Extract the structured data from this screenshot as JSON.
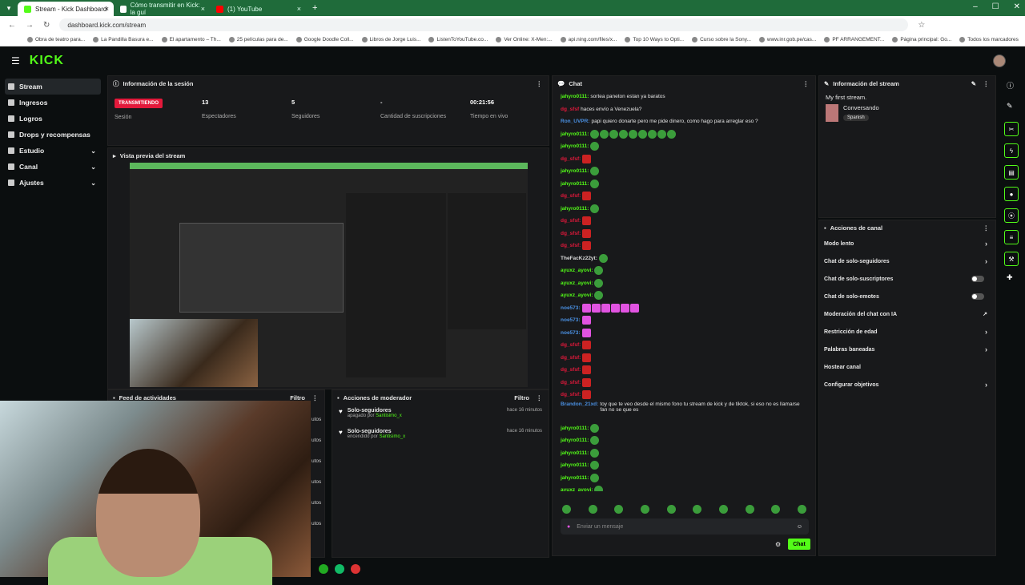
{
  "browser": {
    "tabs": [
      {
        "label": "Stream - Kick Dashboard",
        "active": true
      },
      {
        "label": "Cómo transmitir en Kick: la guí"
      },
      {
        "label": "(1) YouTube"
      }
    ],
    "url": "dashboard.kick.com/stream",
    "bookmarks": [
      "Obra de teatro para...",
      "La Pandilla Basura e...",
      "El apartamento – Th...",
      "25 películas para de...",
      "Google Doodle Coll...",
      "Libros de Jorge Luis...",
      "ListenToYouTube.co...",
      "Ver Online: X-Men:...",
      "api.ning.com/files/x...",
      "Top 10 Ways to Opti...",
      "Curso sobre la Sony...",
      "www.inr.gob.pe/cas...",
      "PF ARRANGEMENT...",
      "Página principal: Go...",
      "Todos los marcadores"
    ]
  },
  "brand": {
    "logo": "KICK",
    "accent": "#53fc18"
  },
  "sidebar": {
    "items": [
      {
        "label": "Stream",
        "active": true
      },
      {
        "label": "Ingresos"
      },
      {
        "label": "Logros"
      },
      {
        "label": "Drops y recompensas"
      },
      {
        "label": "Estudio",
        "chevron": true
      },
      {
        "label": "Canal",
        "chevron": true
      },
      {
        "label": "Ajustes",
        "chevron": true
      }
    ]
  },
  "session": {
    "title": "Información de la sesión",
    "live_badge": "TRANSMITIENDO",
    "live_label": "Sesión",
    "stats": [
      {
        "value": "13",
        "label": "Espectadores"
      },
      {
        "value": "5",
        "label": "Seguidores"
      },
      {
        "value": "-",
        "label": "Cantidad de suscripciones"
      },
      {
        "value": "00:21:56",
        "label": "Tiempo en vivo"
      }
    ]
  },
  "preview": {
    "title": "Vista previa del stream"
  },
  "activity": {
    "title": "Feed de actividades",
    "filter": "Filtro",
    "side_labels": [
      "utos",
      "utos",
      "utos",
      "utos",
      "utos",
      "utos"
    ]
  },
  "moderator": {
    "title": "Acciones de moderador",
    "filter": "Filtro",
    "items": [
      {
        "title": "Solo-seguidores",
        "action": "apagado por",
        "user": "Santisimo_x",
        "time": "hace 16 minutos"
      },
      {
        "title": "Solo-seguidores",
        "action": "encendido por",
        "user": "Santisimo_x",
        "time": "hace 16 minutos"
      }
    ]
  },
  "chat": {
    "title": "Chat",
    "messages": [
      {
        "user": "jahyro0111:",
        "color": "#53fc18",
        "text": "sortea paneton estan ya baratos"
      },
      {
        "user": "dg_sfsf",
        "color": "#e3193b",
        "text": "haces envío a Venezuela?"
      },
      {
        "user": "Ron_UVPR:",
        "color": "#4a90e2",
        "text": "papi quiero donarte pero me pide dinero, como hago para arreglar eso ?"
      },
      {
        "user": "jahyro0111:",
        "color": "#53fc18",
        "emotes": 9,
        "et": "g"
      },
      {
        "user": "jahyro0111:",
        "color": "#53fc18",
        "emotes": 1,
        "et": "g"
      },
      {
        "user": "dg_sfsf:",
        "color": "#e3193b",
        "emotes": 1,
        "et": "r"
      },
      {
        "user": "jahyro0111:",
        "color": "#53fc18",
        "emotes": 1,
        "et": "g"
      },
      {
        "user": "jahyro0111:",
        "color": "#53fc18",
        "emotes": 1,
        "et": "g"
      },
      {
        "user": "dg_sfsf:",
        "color": "#e3193b",
        "emotes": 1,
        "et": "r"
      },
      {
        "user": "jahyro0111:",
        "color": "#53fc18",
        "emotes": 1,
        "et": "g"
      },
      {
        "user": "dg_sfsf:",
        "color": "#e3193b",
        "emotes": 1,
        "et": "r"
      },
      {
        "user": "dg_sfsf:",
        "color": "#e3193b",
        "emotes": 1,
        "et": "r"
      },
      {
        "user": "dg_sfsf:",
        "color": "#e3193b",
        "emotes": 1,
        "et": "r"
      },
      {
        "user": "TheFacKz22yt:",
        "color": "#ddd",
        "emotes": 1,
        "et": "g"
      },
      {
        "user": "ayuxz_ayovi:",
        "color": "#53fc18",
        "emotes": 1,
        "et": "g"
      },
      {
        "user": "ayuxz_ayovi:",
        "color": "#53fc18",
        "emotes": 1,
        "et": "g"
      },
      {
        "user": "ayuxz_ayovi:",
        "color": "#53fc18",
        "emotes": 1,
        "et": "g"
      },
      {
        "user": "noe573:",
        "color": "#4a90e2",
        "emotes": 6,
        "et": "p"
      },
      {
        "user": "noe573:",
        "color": "#4a90e2",
        "emotes": 1,
        "et": "p"
      },
      {
        "user": "noe573:",
        "color": "#4a90e2",
        "emotes": 1,
        "et": "p"
      },
      {
        "user": "dg_sfsf:",
        "color": "#e3193b",
        "emotes": 1,
        "et": "r"
      },
      {
        "user": "dg_sfsf:",
        "color": "#e3193b",
        "emotes": 1,
        "et": "r"
      },
      {
        "user": "dg_sfsf:",
        "color": "#e3193b",
        "emotes": 1,
        "et": "r"
      },
      {
        "user": "dg_sfsf:",
        "color": "#e3193b",
        "emotes": 1,
        "et": "r"
      },
      {
        "user": "dg_sfsf:",
        "color": "#e3193b",
        "emotes": 1,
        "et": "r"
      },
      {
        "user": "Brandon_21xd:",
        "color": "#4a90e2",
        "text": "toy que te veo desde el mismo fono tu stream de kick y de tiktok, si eso no es llamarse fan no se que es",
        "tall": true
      },
      {
        "user": "jahyro0111:",
        "color": "#53fc18",
        "emotes": 1,
        "et": "g"
      },
      {
        "user": "jahyro0111:",
        "color": "#53fc18",
        "emotes": 1,
        "et": "g"
      },
      {
        "user": "jahyro0111:",
        "color": "#53fc18",
        "emotes": 1,
        "et": "g"
      },
      {
        "user": "jahyro0111:",
        "color": "#53fc18",
        "emotes": 1,
        "et": "g"
      },
      {
        "user": "jahyro0111:",
        "color": "#53fc18",
        "emotes": 1,
        "et": "g"
      },
      {
        "user": "ayuxz_ayovi:",
        "color": "#53fc18",
        "emotes": 1,
        "et": "g"
      }
    ],
    "input_placeholder": "Enviar un mensaje",
    "send_label": "Chat"
  },
  "stream_info": {
    "title": "Información del stream",
    "stream_title": "My first stream.",
    "category": "Conversando",
    "language": "Spanish"
  },
  "channel_actions": {
    "title": "Acciones de canal",
    "items": [
      {
        "label": "Modo lento",
        "kind": "arrow"
      },
      {
        "label": "Chat de solo-seguidores",
        "kind": "arrow"
      },
      {
        "label": "Chat de solo-suscriptores",
        "kind": "toggle"
      },
      {
        "label": "Chat de solo-emotes",
        "kind": "toggle"
      },
      {
        "label": "Moderación del chat con IA",
        "kind": "ext"
      },
      {
        "label": "Restricción de edad",
        "kind": "arrow"
      },
      {
        "label": "Palabras baneadas",
        "kind": "arrow"
      },
      {
        "label": "Hostear canal",
        "kind": "none"
      },
      {
        "label": "Configurar objetivos",
        "kind": "arrow"
      }
    ]
  }
}
